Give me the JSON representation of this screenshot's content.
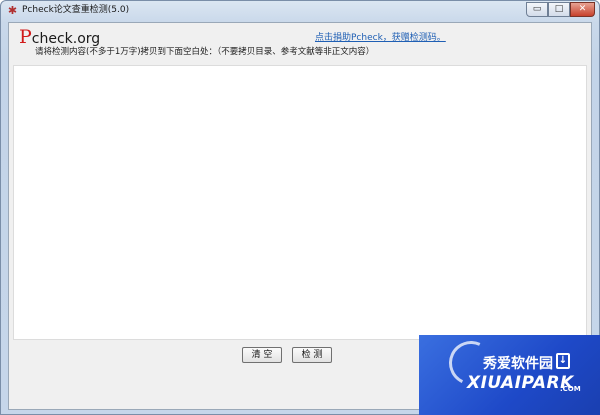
{
  "window": {
    "title": "Pcheck论文查重检测(5.0)",
    "controls": {
      "minimize": "▭",
      "maximize": "□",
      "close": "✕"
    }
  },
  "logo": {
    "p": "P",
    "rest": "check.org"
  },
  "donate_link": "点击捐助Pcheck，获赠检测码。",
  "instruction": "请将检测内容(不多于1万字)拷贝到下面空白处：（不要拷贝目录、参考文献等非正文内容）",
  "text_area": {
    "value": ""
  },
  "buttons": {
    "clear": "清 空",
    "check": "检 测"
  },
  "watermark": {
    "cn": "秀爱软件园",
    "en": "XIUAIPARK",
    "com": ".COM",
    "icon": "download-icon"
  },
  "colors": {
    "logo_accent": "#d11a1a",
    "link": "#1f5fb4",
    "watermark_bg": "#2a56d8"
  }
}
